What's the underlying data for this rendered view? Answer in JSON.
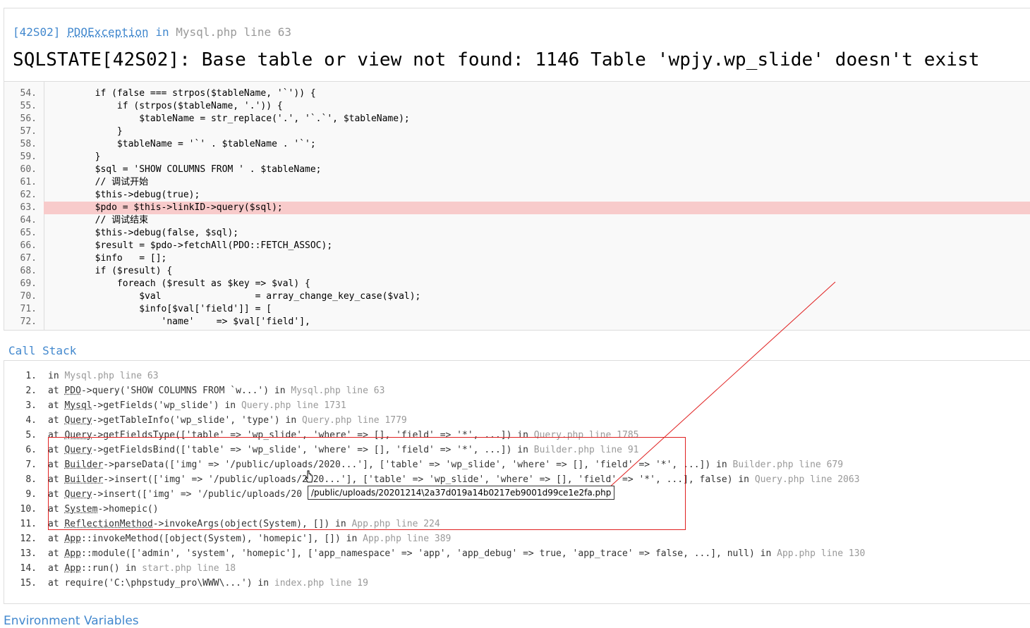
{
  "exception": {
    "code": "[42S02]",
    "class": "PDOException",
    "in_word": "in",
    "file": "Mysql.php line 63",
    "message": "SQLSTATE[42S02]: Base table or view not found: 1146 Table 'wpjy.wp_slide' doesn't exist"
  },
  "source": {
    "highlight_line": "63.",
    "lines": [
      {
        "n": "54.",
        "t": "        if (false === strpos($tableName, '`')) {"
      },
      {
        "n": "55.",
        "t": "            if (strpos($tableName, '.')) {"
      },
      {
        "n": "56.",
        "t": "                $tableName = str_replace('.', '`.`', $tableName);"
      },
      {
        "n": "57.",
        "t": "            }"
      },
      {
        "n": "58.",
        "t": "            $tableName = '`' . $tableName . '`';"
      },
      {
        "n": "59.",
        "t": "        }"
      },
      {
        "n": "60.",
        "t": "        $sql = 'SHOW COLUMNS FROM ' . $tableName;"
      },
      {
        "n": "61.",
        "t": "        // 调试开始"
      },
      {
        "n": "62.",
        "t": "        $this->debug(true);"
      },
      {
        "n": "63.",
        "t": "        $pdo = $this->linkID->query($sql);"
      },
      {
        "n": "64.",
        "t": "        // 调试结束"
      },
      {
        "n": "65.",
        "t": "        $this->debug(false, $sql);"
      },
      {
        "n": "66.",
        "t": "        $result = $pdo->fetchAll(PDO::FETCH_ASSOC);"
      },
      {
        "n": "67.",
        "t": "        $info   = [];"
      },
      {
        "n": "68.",
        "t": "        if ($result) {"
      },
      {
        "n": "69.",
        "t": "            foreach ($result as $key => $val) {"
      },
      {
        "n": "70.",
        "t": "                $val                 = array_change_key_case($val);"
      },
      {
        "n": "71.",
        "t": "                $info[$val['field']] = ["
      },
      {
        "n": "72.",
        "t": "                    'name'    => $val['field'],"
      }
    ]
  },
  "call_stack": {
    "title": "Call Stack",
    "frames": [
      {
        "n": "1.",
        "pre": "in ",
        "fn": "",
        "mid": "",
        "loc": "Mysql.php line 63"
      },
      {
        "n": "2.",
        "pre": "at ",
        "fn": "PDO",
        "mid": "->query('SHOW COLUMNS FROM `w...') in ",
        "loc": "Mysql.php line 63"
      },
      {
        "n": "3.",
        "pre": "at ",
        "fn": "Mysql",
        "mid": "->getFields('wp_slide') in ",
        "loc": "Query.php line 1731"
      },
      {
        "n": "4.",
        "pre": "at ",
        "fn": "Query",
        "mid": "->getTableInfo('wp_slide', 'type') in ",
        "loc": "Query.php line 1779"
      },
      {
        "n": "5.",
        "pre": "at ",
        "fn": "Query",
        "mid": "->getFieldsType(['table' => 'wp_slide', 'where' => [], 'field' => '*', ...]) in ",
        "loc": "Query.php line 1785"
      },
      {
        "n": "6.",
        "pre": "at ",
        "fn": "Query",
        "mid": "->getFieldsBind(['table' => 'wp_slide', 'where' => [], 'field' => '*', ...]) in ",
        "loc": "Builder.php line 91"
      },
      {
        "n": "7.",
        "pre": "at ",
        "fn": "Builder",
        "mid": "->parseData(['img' => '/public/uploads/2020...'], ['table' => 'wp_slide', 'where' => [], 'field' => '*', ...]) in ",
        "loc": "Builder.php line 679"
      },
      {
        "n": "8.",
        "pre": "at ",
        "fn": "Builder",
        "mid": "->insert(['img' => '/public/uploads/2020...'], ['table' => 'wp_slide', 'where' => [], 'field' => '*', ...], false) in ",
        "loc": "Query.php line 2063"
      },
      {
        "n": "9.",
        "pre": "at ",
        "fn": "Query",
        "mid": "->insert(['img' => '/public/uploads/20",
        "loc": ""
      },
      {
        "n": "10.",
        "pre": "at ",
        "fn": "System",
        "mid": "->homepic()",
        "loc": ""
      },
      {
        "n": "11.",
        "pre": "at ",
        "fn": "ReflectionMethod",
        "mid": "->invokeArgs(object(System), []) in ",
        "loc": "App.php line 224"
      },
      {
        "n": "12.",
        "pre": "at ",
        "fn": "App",
        "mid": "::invokeMethod([object(System), 'homepic'], []) in ",
        "loc": "App.php line 389"
      },
      {
        "n": "13.",
        "pre": "at ",
        "fn": "App",
        "mid": "::module(['admin', 'system', 'homepic'], ['app_namespace' => 'app', 'app_debug' => true, 'app_trace' => false, ...], null) in ",
        "loc": "App.php line 130"
      },
      {
        "n": "14.",
        "pre": "at ",
        "fn": "App",
        "mid": "::run() in ",
        "loc": "start.php line 18"
      },
      {
        "n": "15.",
        "pre": "at ",
        "fn": "",
        "mid": "require('C:\\phpstudy_pro\\WWW\\...') in ",
        "loc": "index.php line 19"
      }
    ]
  },
  "tooltip": "/public/uploads/20201214\\2a37d019a14b0217eb9001d99ce1e2fa.php",
  "environment_title": "Environment Variables",
  "colors": {
    "accent": "#4288ce",
    "highlight": "#f8cbcb",
    "annotation": "#e02020"
  }
}
